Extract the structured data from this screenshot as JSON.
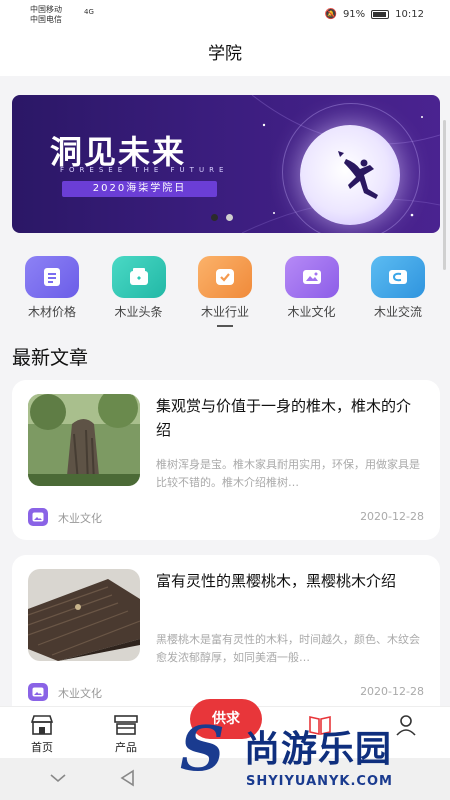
{
  "status_bar": {
    "carrier_1": "中国移动",
    "carrier_2": "中国电信",
    "network": "4G",
    "battery": "91%",
    "time": "10:12"
  },
  "header": {
    "title": "学院"
  },
  "banner": {
    "title": "洞见未来",
    "subtitle": "FORESEE THE FUTURE",
    "tag": "2020海柒学院日",
    "active_slide": 1,
    "slide_count": 2
  },
  "categories": [
    {
      "label": "木材价格",
      "icon": "document-icon",
      "color": "#7a6df0",
      "active": false
    },
    {
      "label": "木业头条",
      "icon": "news-box-icon",
      "color": "#2ec9b6",
      "active": false
    },
    {
      "label": "木业行业",
      "icon": "checkmark-card-icon",
      "color": "#f59a4e",
      "active": true
    },
    {
      "label": "木业文化",
      "icon": "picture-icon",
      "color": "#a272f0",
      "active": false
    },
    {
      "label": "木业交流",
      "icon": "chat-card-icon",
      "color": "#3aa6e8",
      "active": false
    }
  ],
  "section": {
    "title": "最新文章"
  },
  "articles": [
    {
      "title": "集观赏与价值于一身的椎木，椎木的介绍",
      "excerpt": "椎树浑身是宝。椎木家具耐用实用，环保，用做家具是比较不错的。椎木介绍椎树…",
      "category": "木业文化",
      "date": "2020-12-28"
    },
    {
      "title": "富有灵性的黑樱桃木，黑樱桃木介绍",
      "excerpt": "黑樱桃木是富有灵性的木料，时间越久，颜色、木纹会愈发浓郁醇厚，如同美酒一般…",
      "category": "木业文化",
      "date": "2020-12-28"
    }
  ],
  "tabbar": {
    "home": "首页",
    "products": "产品",
    "publish": "供求"
  },
  "watermark": {
    "mark": "S",
    "text": "尚游乐园",
    "url": "SHYIYUANYK.COM"
  }
}
